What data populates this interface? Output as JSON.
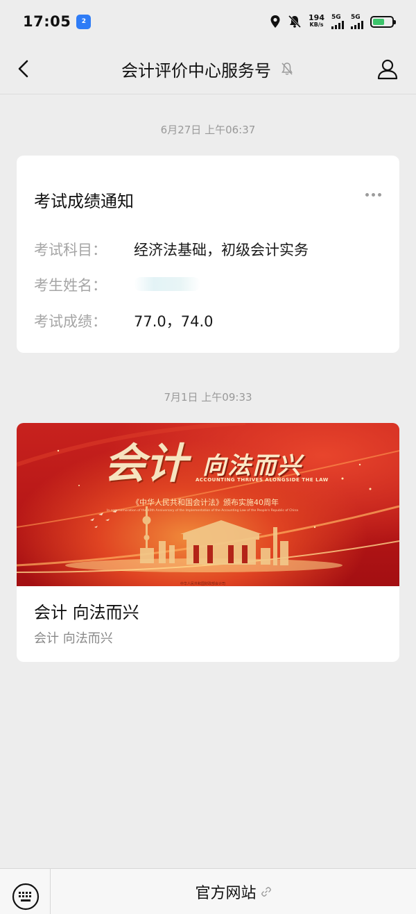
{
  "status_bar": {
    "time": "17:05",
    "app_badge": "2",
    "speed_value": "194",
    "speed_unit": "KB/s",
    "sim1_label": "5G",
    "sim2_label": "5G"
  },
  "header": {
    "title": "会计评价中心服务号"
  },
  "messages": [
    {
      "timestamp": "6月27日 上午06:37",
      "title": "考试成绩通知",
      "rows": [
        {
          "label": "考试科目：",
          "value": "经济法基础，初级会计实务"
        },
        {
          "label": "考生姓名：",
          "value": ""
        },
        {
          "label": "考试成绩：",
          "value": "77.0，74.0"
        }
      ]
    },
    {
      "timestamp": "7月1日 上午09:33",
      "banner": {
        "big1": "会计",
        "big2": "向法而兴",
        "english": "ACCOUNTING THRIVES ALONGSIDE THE LAW",
        "chinese": "《中华人民共和国会计法》颁布实施40周年",
        "tiny": "In commemoration of the 40th Anniversary of the Implementation of the Accounting Law of the People's Republic of China",
        "org": "中华人民共和国财政部会计司"
      },
      "title": "会计 向法而兴",
      "subtitle": "会计 向法而兴"
    }
  ],
  "bottom_menu": {
    "item_label": "官方网站"
  },
  "colors": {
    "background": "#ededed",
    "card": "#ffffff",
    "label_gray": "#a5a5a5",
    "banner_red": "#c8221e"
  }
}
